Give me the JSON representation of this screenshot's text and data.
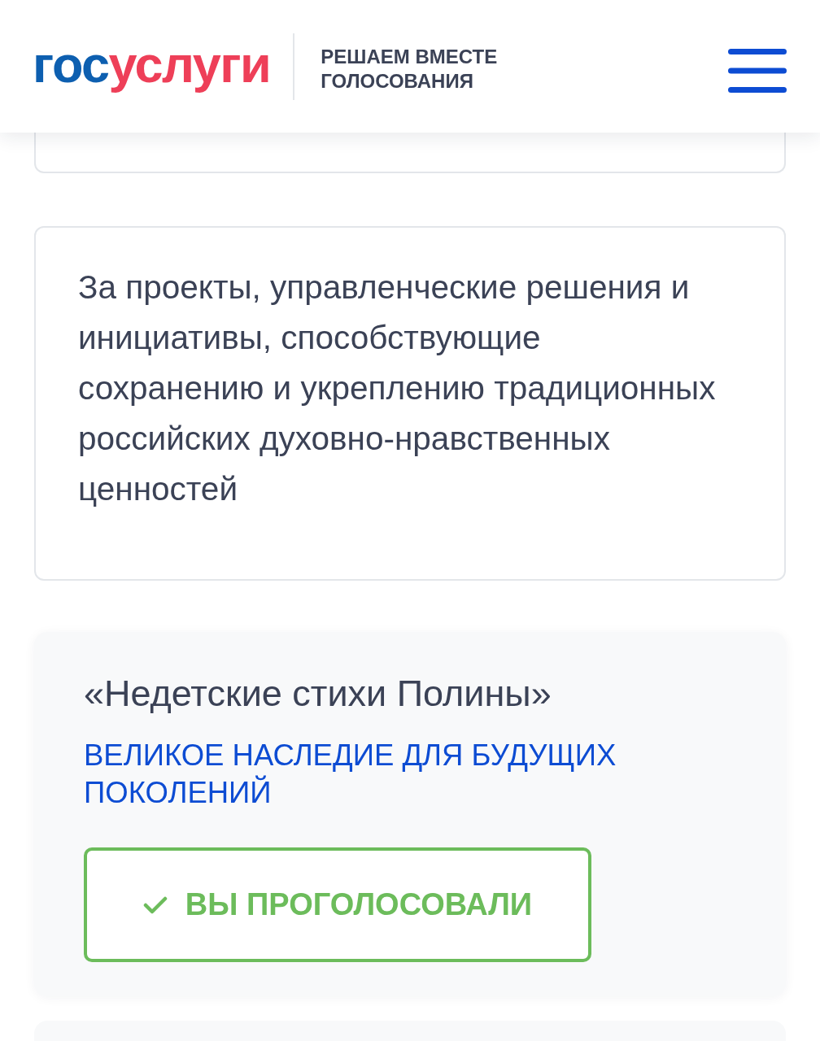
{
  "header": {
    "logo": [
      {
        "text": "гос",
        "color": "#0d5fb0"
      },
      {
        "text": "услуги",
        "color": "#ee3f58"
      }
    ],
    "subtitle_lines": [
      "РЕШАЕМ ВМЕСТЕ",
      "ГОЛОСОВАНИЯ"
    ]
  },
  "nomination_card": {
    "text": "За проекты, управленческие решения и инициативы, способствующие сохранению и укреплению традиционных российских духовно-нравственных ценностей"
  },
  "project": {
    "title": "«Недетские стихи Полины»",
    "category": "ВЕЛИКОЕ НАСЛЕДИЕ ДЛЯ БУДУЩИХ ПОКОЛЕНИЙ",
    "vote_button": {
      "label": "ВЫ ПРОГОЛОСОВАЛИ",
      "voted": true
    }
  }
}
